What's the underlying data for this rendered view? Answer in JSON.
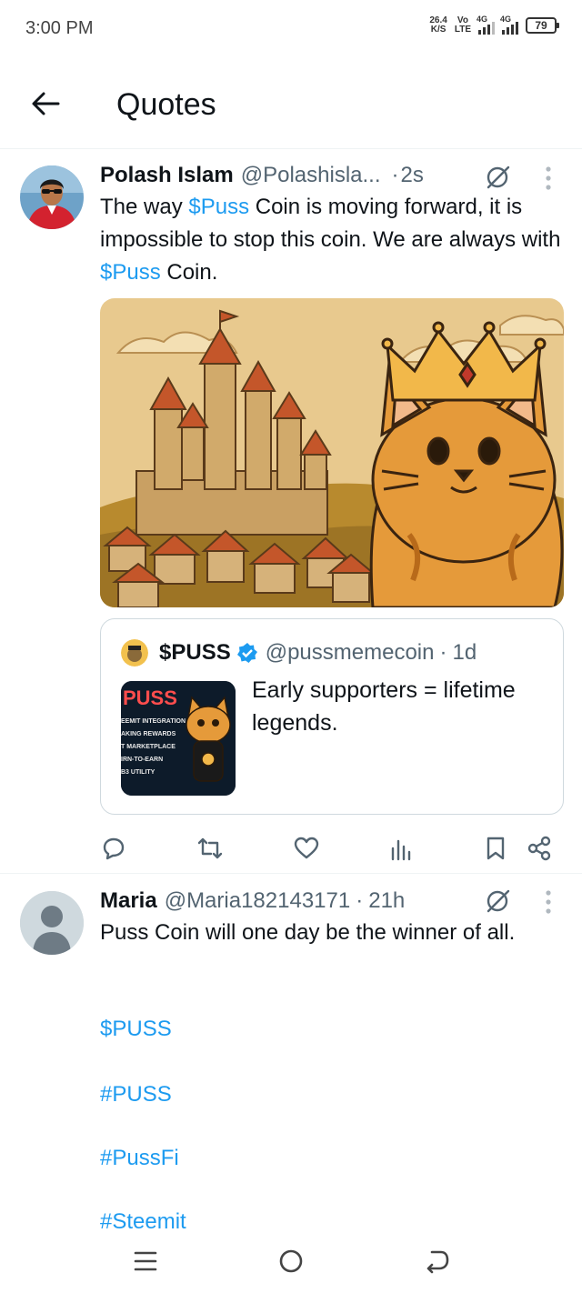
{
  "status_bar": {
    "time": "3:00 PM",
    "net_speed_value": "26.4",
    "net_speed_unit": "K/S",
    "volte_top": "Vo",
    "volte_bottom": "LTE",
    "sim1_label": "4G",
    "sim2_label": "4G",
    "battery": "79"
  },
  "header": {
    "title": "Quotes",
    "back_icon": "arrow-left-icon"
  },
  "colors": {
    "link": "#1d9bf0",
    "text": "#0f1419",
    "muted": "#536471",
    "border": "#cfd9de",
    "verified": "#1d9bf0"
  },
  "tweets": [
    {
      "name": "Polash Islam",
      "handle": "@Polashisla...",
      "dot": "·",
      "time": "2s",
      "body": [
        {
          "text": "The way ",
          "type": "text"
        },
        {
          "text": "$Puss",
          "type": "cashtag"
        },
        {
          "text": " Coin is moving forward, it is impossible to stop this coin. We are always with ",
          "type": "text"
        },
        {
          "text": "$Puss",
          "type": "cashtag"
        },
        {
          "text": " Coin.",
          "type": "text"
        }
      ],
      "media": "crowned-cat-castle-illustration",
      "quote": {
        "name": "$PUSS",
        "handle": "@pussmemecoin",
        "dot": "·",
        "time": "1d",
        "text": "Early supporters = lifetime legends.",
        "thumb": {
          "title": "PUSS",
          "lines": [
            "EEMIT INTEGRATION",
            "AKING REWARDS",
            "T MARKETPLACE",
            "IRN-TO-EARN",
            "B3 UTILITY"
          ]
        }
      },
      "actions": [
        "reply-icon",
        "retweet-icon",
        "like-icon",
        "views-icon",
        "bookmark-icon",
        "share-icon"
      ]
    },
    {
      "name": "Maria",
      "handle": "@Maria182143171",
      "dot": "·",
      "time": "21h",
      "body_text": "Puss Coin will one day be the winner of all.",
      "hashtags": [
        "$PUSS",
        "#PUSS",
        "#PussFi",
        "#Steemit"
      ]
    }
  ],
  "nav": {
    "menu_icon": "recent-apps-icon",
    "home_icon": "home-circle-icon",
    "back_icon": "back-icon"
  }
}
